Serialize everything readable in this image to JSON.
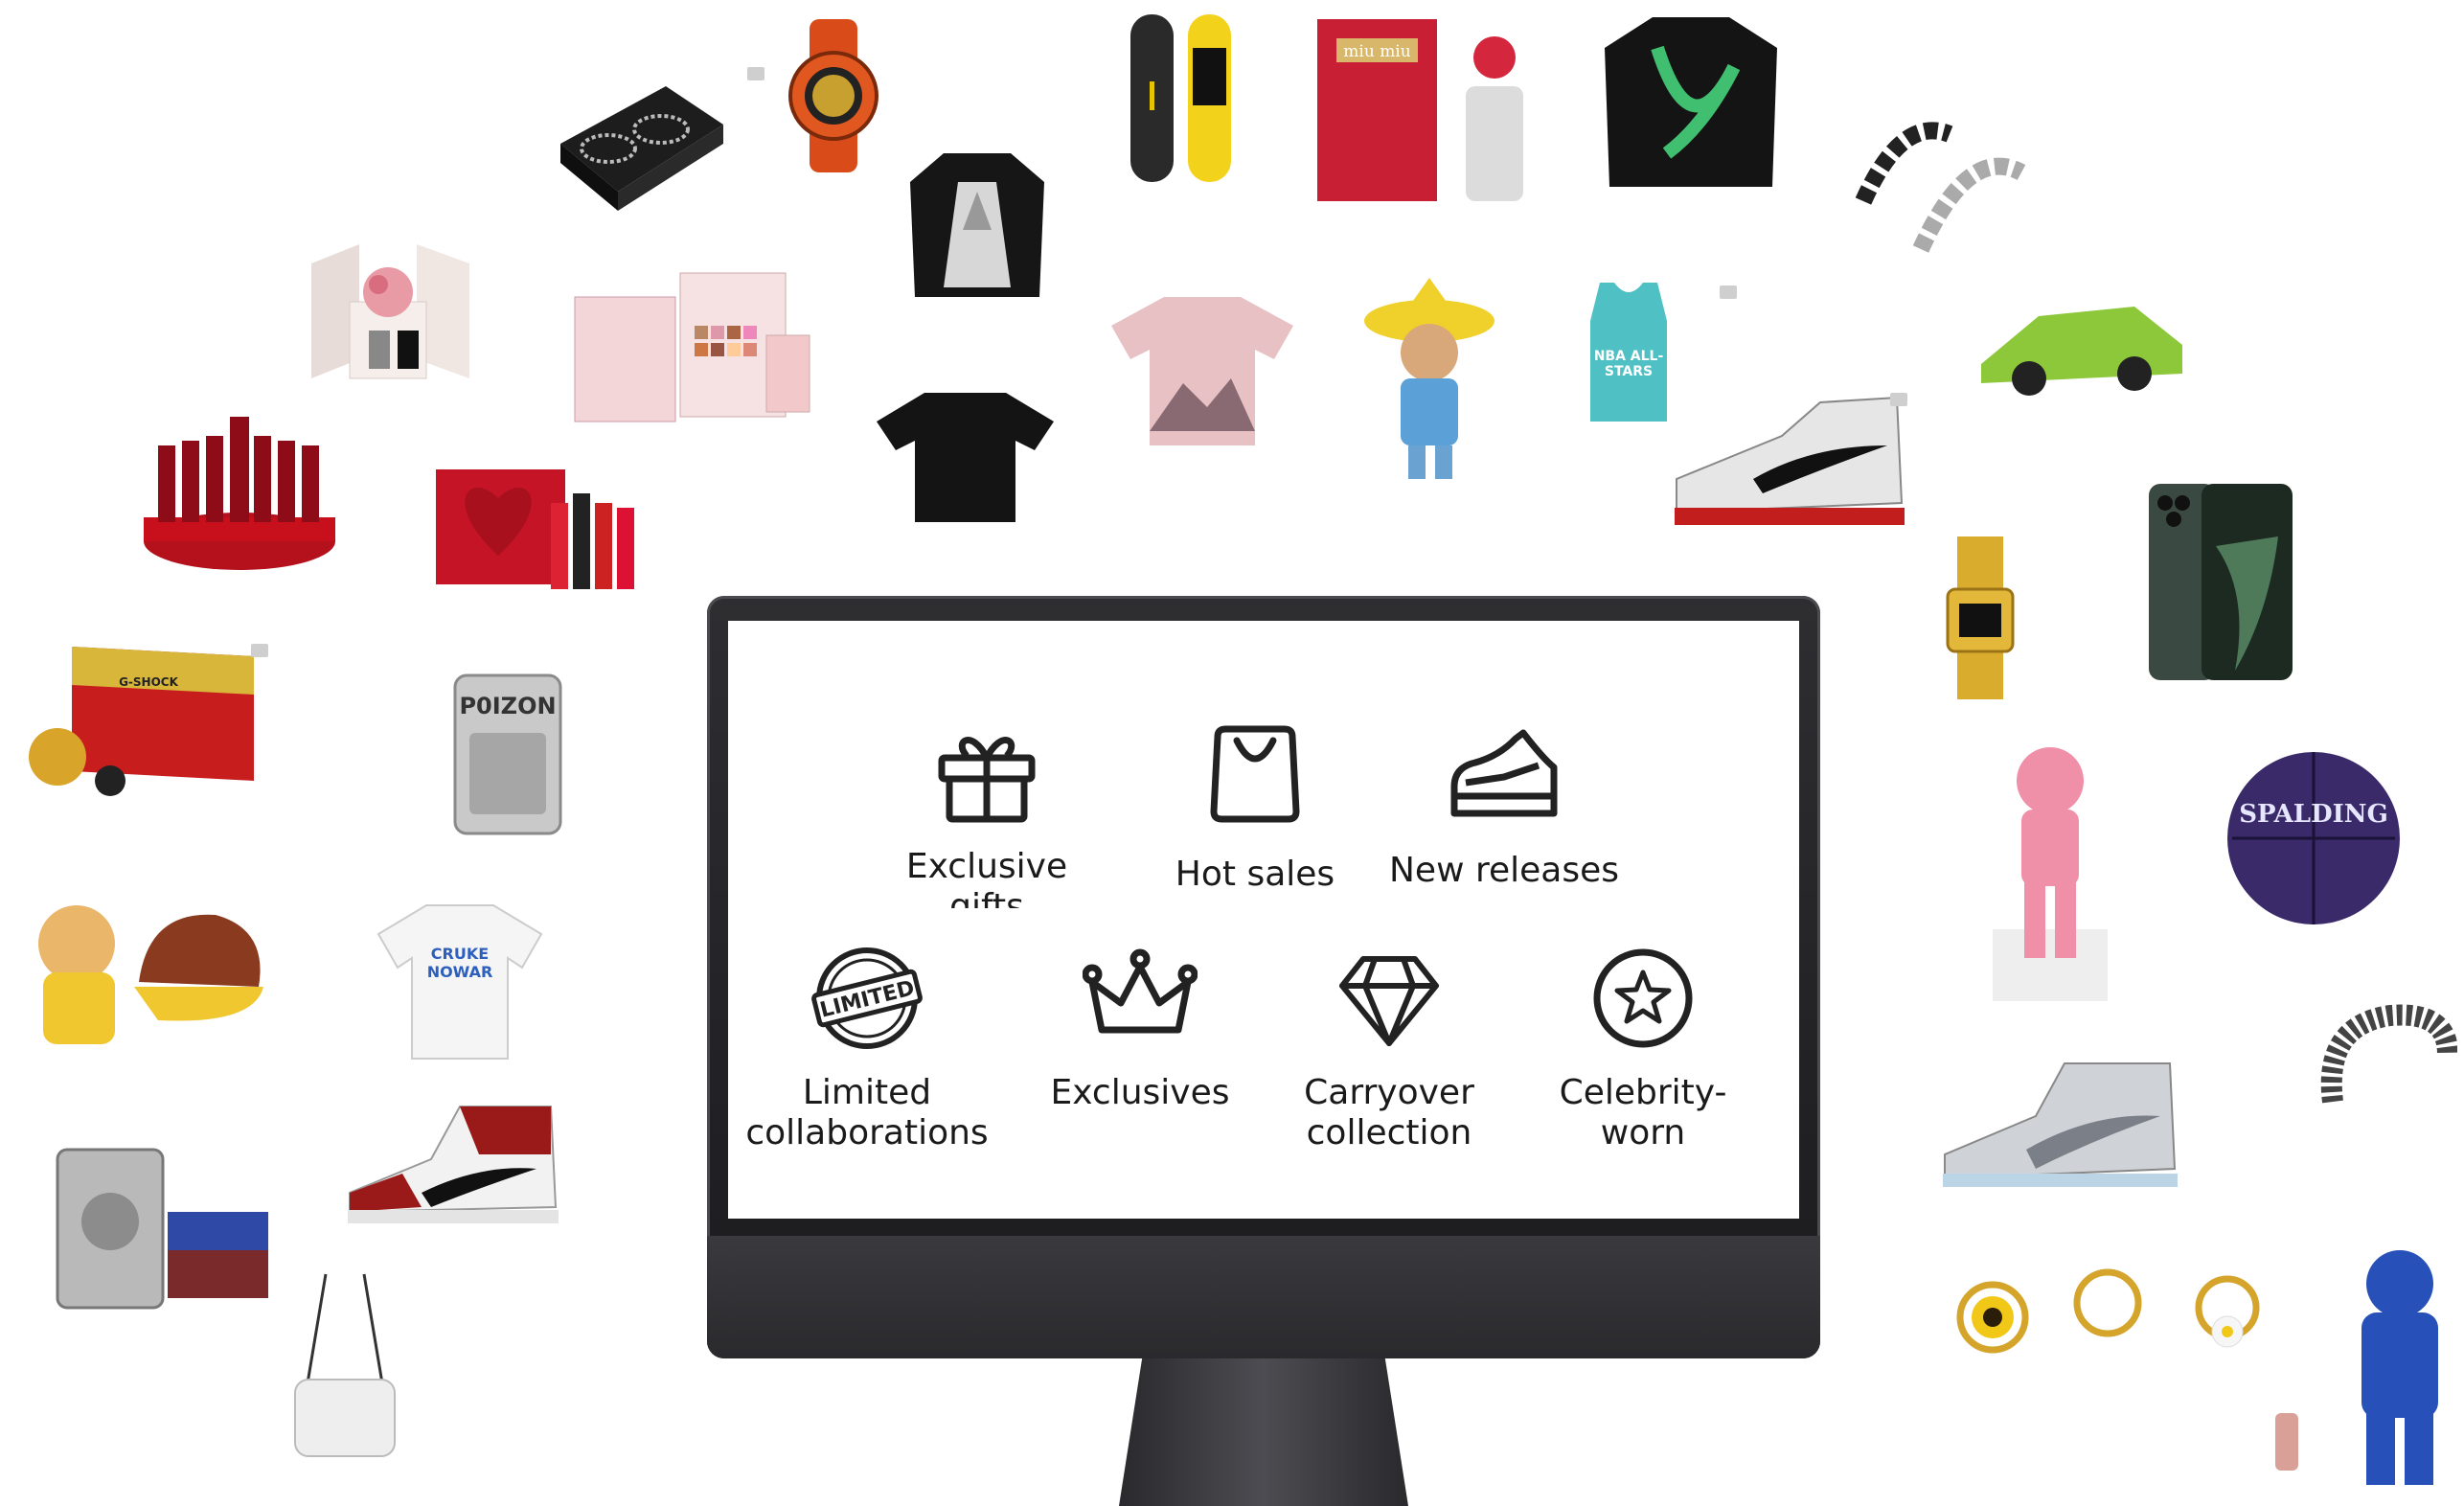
{
  "screen_menu": {
    "row1": [
      {
        "label": "Exclusive\ngifts",
        "icon": "gift-icon"
      },
      {
        "label": "Hot sales",
        "icon": "shopping-bag-icon"
      },
      {
        "label": "New releases",
        "icon": "sneaker-icon"
      }
    ],
    "row2": [
      {
        "label": "Limited\ncollaborations",
        "icon": "limited-stamp-icon"
      },
      {
        "label": "Exclusives",
        "icon": "crown-icon"
      },
      {
        "label": "Carryover\ncollection",
        "icon": "diamond-icon"
      },
      {
        "label": "Celebrity-\nworn",
        "icon": "star-circle-icon"
      }
    ]
  },
  "products": {
    "lighter_brand": "P0IZON",
    "tshirt_print": "CRUKE NOWAR",
    "jersey_text": "NBA ALL-STARS",
    "ball_brand": "SPALDING",
    "watch_box_brand": "G-SHOCK",
    "perfume_brand": "miu miu"
  },
  "colors": {
    "icon_stroke": "#222222",
    "text": "#1a1a1a",
    "monitor": "#1f1f22"
  }
}
